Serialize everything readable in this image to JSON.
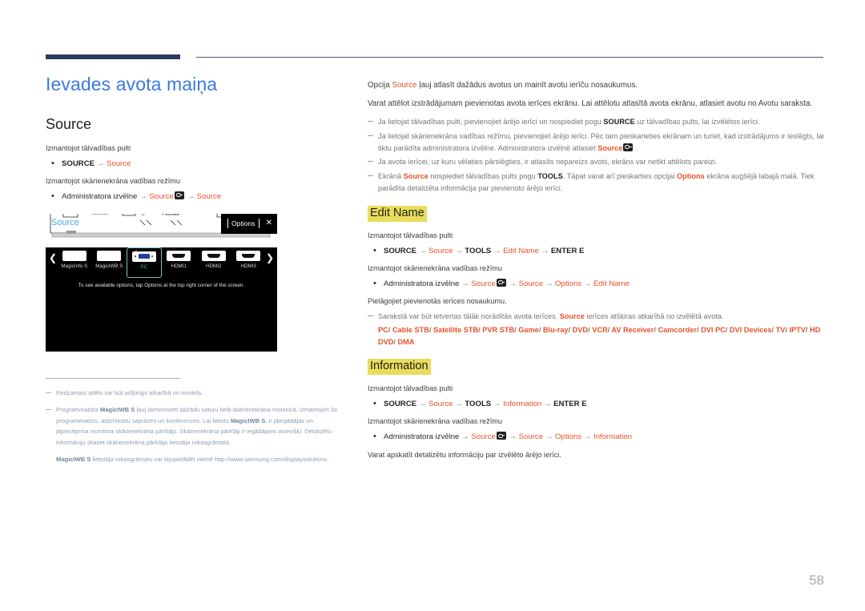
{
  "document": {
    "title": "Ievades avota maiņa",
    "page_number": "58",
    "accent_blue": "#3a7ae0",
    "accent_orange": "#e8512a",
    "highlight_yellow": "#e9dd5c",
    "rule_navy": "#2e3c5c"
  },
  "left": {
    "section_title": "Source",
    "remote_label": "Izmantojot tālvadības pulti",
    "remote_bullet": {
      "key": "SOURCE",
      "arrow": "→",
      "target": "Source"
    },
    "touch_label": "Izmantojot skārienekrāna vadības režīmu",
    "touch_bullet": {
      "menu": "Administratora izvēlne",
      "arrow1": "→",
      "source1": "Source",
      "arrow2": "→",
      "source2": "Source"
    },
    "device_shot": {
      "source_label": "Source",
      "options_label": "Options",
      "close_icon": "✕",
      "prev_arrow": "❮",
      "next_arrow": "❯",
      "items": [
        {
          "label": "MagicInfo S",
          "type": "plain",
          "selected": false
        },
        {
          "label": "MagicIWB S",
          "type": "plain",
          "selected": false
        },
        {
          "label": "PC",
          "type": "vga",
          "selected": true
        },
        {
          "label": "HDMI1",
          "type": "hdmi",
          "selected": false
        },
        {
          "label": "HDMI2",
          "type": "hdmi",
          "selected": false
        },
        {
          "label": "HDMI3",
          "type": "hdmi",
          "selected": false
        }
      ],
      "hint": "To see available options, tap Options at the top right corner of the screen."
    },
    "footnotes": [
      "Redzamais attēls var būt atšķirīgs atkarībā no modeļa.",
      "Programmatūra MagicIWB S ļauj demonstrēt dažādu saturu lielā skārienekrāna monitorā. Izmantojiet šo programmatūru, atdzīvinātu sapulces un konferences. Lai lietotu MagicIWB S, ir jāiegādājas un jāpiestiprina monitora skārienekrāna pārklājs. Skārienekrāna pārklāji ir iegādājami atsevišķi. Detalizētu informāciju skatiet skārienekrāna pārklāja lietotāja rokasgrāmatā."
    ],
    "footnote_extra": "MagicIWB S lietotāja rokasgrāmatu var lejupielādēt vietnē http://www.samsung.com/displaysolutions.",
    "footnote_bold_terms": {
      "magiciwb": "MagicIWB S"
    }
  },
  "right": {
    "intro": {
      "p1_before": "Opcija ",
      "p1_term": "Source",
      "p1_after": " ļauj atlasīt dažādus avotus un mainīt avotu ierīču nosaukumus.",
      "p2": "Varat attēlot izstrādājumam pievienotas avota ierīces ekrānu. Lai attēlotu atlasītā avota ekrānu, atlasiet avotu no Avotu saraksta."
    },
    "intro_notes": [
      "Ja lietojat tālvadības pulti, pievienojiet ārējo ierīci un nospiediet pogu SOURCE uz tālvadības pults, lai izvēlētos ierīci.",
      "Ja lietojat skārienekrāna vadības režīmu, pievienojiet ārējo ierīci. Pēc tam pieskarieties ekrānam un turiet, kad izstrādājums ir ieslēgts, lai tiktu parādīta administratora izvēlne. Administratora izvēlnē atlasiet Source .",
      "Ja avota ierīcei, uz kuru vēlaties pārslēgties, ir atlasīts nepareizs avots, ekrāns var netikt attēlots pareizi.",
      "Ekrānā Source nospiediet tālvadības pults pogu TOOLS. Tāpat varat arī pieskarties opcijai Options ekrāna augšējā labajā malā. Tiek parādīta detalizēta informācija par pievienoto ārējo ierīci."
    ],
    "edit_name": {
      "heading": "Edit Name",
      "remote_label": "Izmantojot tālvadības pulti",
      "remote_path": {
        "p1": "SOURCE",
        "p2": "Source",
        "p3": "TOOLS",
        "p4": "Edit Name",
        "p5": "ENTER E"
      },
      "touch_label": "Izmantojot skārienekrāna vadības režīmu",
      "touch_path": {
        "p1": "Administratora izvēlne",
        "p2": "Source",
        "p3": "Source",
        "p4": "Options",
        "p5": "Edit Name"
      },
      "desc": "Pielāgojiet pievienotās ierīces nosaukumu.",
      "note_before": "Sarakstā var būt ietvertas tālāk norādītās avota ierīces. ",
      "note_term": "Source",
      "note_after": " ierīces atšķiras atkarībā no izvēlētā avota.",
      "device_list": [
        "PC",
        "Cable STB",
        "Satellite STB",
        "PVR STB",
        "Game",
        "Blu-ray",
        "DVD",
        "VCR",
        "AV Receiver",
        "Camcorder",
        "DVI PC",
        "DVI Devices",
        "TV",
        "IPTV",
        "HD DVD",
        "DMA"
      ]
    },
    "information": {
      "heading": "Information",
      "remote_label": "Izmantojot tālvadības pulti",
      "remote_path": {
        "p1": "SOURCE",
        "p2": "Source",
        "p3": "TOOLS",
        "p4": "Information",
        "p5": "ENTER E"
      },
      "touch_label": "Izmantojot skārienekrāna vadības režīmu",
      "touch_path": {
        "p1": "Administratora izvēlne",
        "p2": "Source",
        "p3": "Source",
        "p4": "Options",
        "p5": "Information"
      },
      "desc": "Varat apskatīt detalizētu informāciju par izvēlēto ārējo ierīci."
    }
  },
  "symbols": {
    "arrow": "→",
    "slash": "/"
  }
}
